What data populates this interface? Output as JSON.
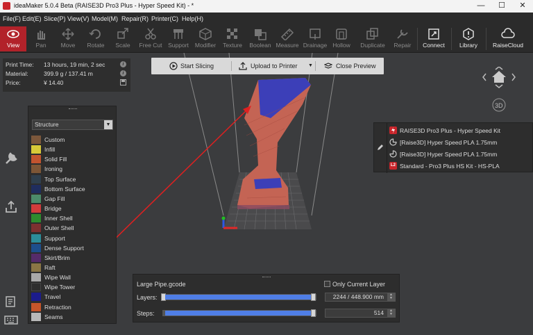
{
  "window": {
    "title": "ideaMaker 5.0.4 Beta (RAISE3D Pro3 Plus - Hyper Speed Kit) - *",
    "minimize": "—",
    "maximize": "☐",
    "close": "✕"
  },
  "menu": [
    "File(F)",
    "Edit(E)",
    "Slice(P)",
    "View(V)",
    "Model(M)",
    "Repair(R)",
    "Printer(C)",
    "Help(H)"
  ],
  "toolbar": {
    "view": "View",
    "pan": "Pan",
    "move": "Move",
    "rotate": "Rotate",
    "scale": "Scale",
    "free_cut": "Free Cut",
    "support": "Support",
    "modifier": "Modifier",
    "texture": "Texture",
    "boolean": "Boolean",
    "measure": "Measure",
    "drainage": "Drainage",
    "hollow": "Hollow",
    "duplicate": "Duplicate",
    "repair": "Repair",
    "connect": "Connect",
    "library": "Library",
    "raisecloud": "RaiseCloud"
  },
  "info": {
    "print_time_label": "Print Time:",
    "print_time": "13 hours, 19 min, 2 sec",
    "material_label": "Material:",
    "material": "399.9 g / 137.41 m",
    "price_label": "Price:",
    "price": "¥  14.40"
  },
  "slicebar": {
    "start": "Start Slicing",
    "upload": "Upload to Printer",
    "close_preview": "Close Preview"
  },
  "legend": {
    "selected": "Structure",
    "items": [
      {
        "label": "Custom",
        "color": "#7b573b"
      },
      {
        "label": "Infill",
        "color": "#d7c938"
      },
      {
        "label": "Solid Fill",
        "color": "#c2542f"
      },
      {
        "label": "Ironing",
        "color": "#7d5636"
      },
      {
        "label": "Top Surface",
        "color": "#2f3f4d"
      },
      {
        "label": "Bottom Surface",
        "color": "#1f2d5e"
      },
      {
        "label": "Gap Fill",
        "color": "#4c8b6a"
      },
      {
        "label": "Bridge",
        "color": "#d13b3b"
      },
      {
        "label": "Inner Shell",
        "color": "#2e8b2e"
      },
      {
        "label": "Outer Shell",
        "color": "#7d3030"
      },
      {
        "label": "Support",
        "color": "#2c8d9a"
      },
      {
        "label": "Dense Support",
        "color": "#1d4f8c"
      },
      {
        "label": "Skirt/Brim",
        "color": "#552b6a"
      },
      {
        "label": "Raft",
        "color": "#8a7645"
      },
      {
        "label": "Wipe Wall",
        "color": "#a9a9a9"
      },
      {
        "label": "Wipe Tower",
        "color": "#2d2d2d"
      },
      {
        "label": "Travel",
        "color": "#1c1c8c"
      },
      {
        "label": "Retraction",
        "color": "#c6552a"
      },
      {
        "label": "Seams",
        "color": "#b9b9b9"
      }
    ]
  },
  "printer": {
    "model": "RAISE3D Pro3 Plus - Hyper Speed Kit",
    "filament_left": "[Raise3D] Hyper Speed PLA 1.75mm",
    "filament_right": "[Raise3D] Hyper Speed PLA 1.75mm",
    "profile": "Standard - Pro3 Plus HS Kit - HS-PLA",
    "profile_badge": "L2"
  },
  "layers": {
    "filename": "Large Pipe.gcode",
    "only_current": "Only Current Layer",
    "layers_label": "Layers:",
    "layers_value": "2244 / 448.900 mm",
    "layers_fraction": 1.0,
    "steps_label": "Steps:",
    "steps_value": "514",
    "steps_fraction": 1.0
  },
  "colors": {
    "accent": "#b2222a",
    "slider": "#4f7ee6",
    "annotation_arrow": "#e02020"
  }
}
